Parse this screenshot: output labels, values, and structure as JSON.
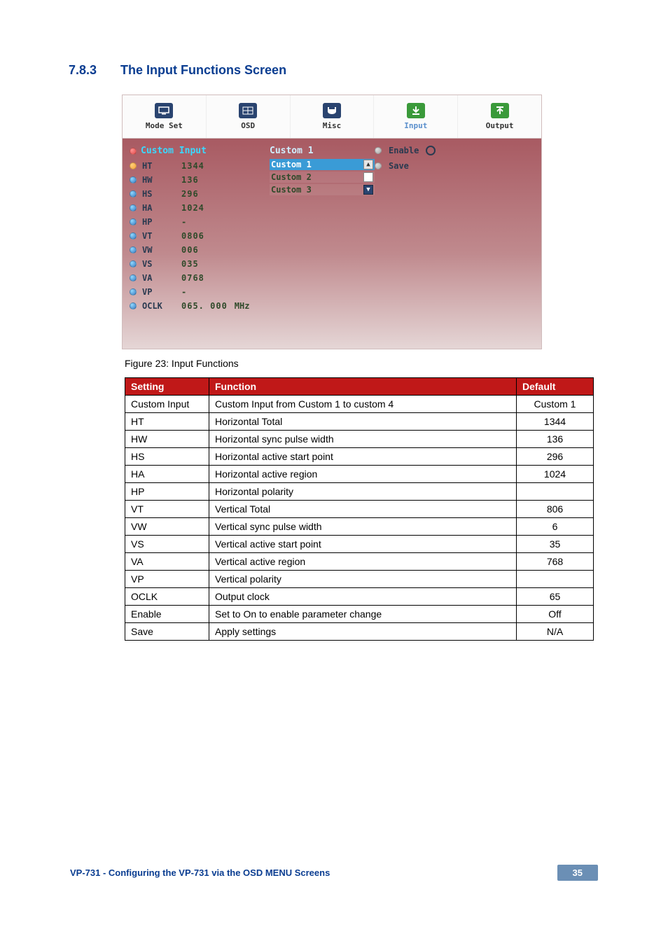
{
  "section": {
    "number": "7.8.3",
    "title": "The Input Functions Screen"
  },
  "osd": {
    "tabs": {
      "modeset": "Mode Set",
      "osd": "OSD",
      "misc": "Misc",
      "input": "Input",
      "output": "Output"
    },
    "headline_custom_input": "Custom Input",
    "headline_custom_value": "Custom 1",
    "enable_label": "Enable",
    "save_label": "Save",
    "custom_list": {
      "c1": "Custom 1",
      "c2": "Custom 2",
      "c3": "Custom 3"
    },
    "params": {
      "ht": {
        "label": "HT",
        "value": "1344"
      },
      "hw": {
        "label": "HW",
        "value": "136"
      },
      "hs": {
        "label": "HS",
        "value": "296"
      },
      "ha": {
        "label": "HA",
        "value": "1024"
      },
      "hp": {
        "label": "HP",
        "value": "-"
      },
      "vt": {
        "label": "VT",
        "value": "0806"
      },
      "vw": {
        "label": "VW",
        "value": "006"
      },
      "vs": {
        "label": "VS",
        "value": "035"
      },
      "va": {
        "label": "VA",
        "value": "0768"
      },
      "vp": {
        "label": "VP",
        "value": "-"
      },
      "oclk": {
        "label": "OCLK",
        "value": "065. 000",
        "unit": "MHz"
      }
    }
  },
  "caption": "Figure 23: Input Functions",
  "table": {
    "headers": {
      "setting": "Setting",
      "function": "Function",
      "default": "Default"
    },
    "rows": {
      "r0": {
        "s": "Custom Input",
        "f": "Custom Input from Custom 1 to custom 4",
        "d": "Custom 1"
      },
      "r1": {
        "s": "HT",
        "f": "Horizontal Total",
        "d": "1344"
      },
      "r2": {
        "s": "HW",
        "f": "Horizontal sync pulse width",
        "d": "136"
      },
      "r3": {
        "s": "HS",
        "f": "Horizontal active start point",
        "d": "296"
      },
      "r4": {
        "s": "HA",
        "f": "Horizontal active region",
        "d": "1024"
      },
      "r5": {
        "s": "HP",
        "f": "Horizontal polarity",
        "d": ""
      },
      "r6": {
        "s": "VT",
        "f": "Vertical Total",
        "d": "806"
      },
      "r7": {
        "s": "VW",
        "f": "Vertical sync pulse width",
        "d": "6"
      },
      "r8": {
        "s": "VS",
        "f": "Vertical active start point",
        "d": "35"
      },
      "r9": {
        "s": "VA",
        "f": "Vertical active region",
        "d": "768"
      },
      "r10": {
        "s": "VP",
        "f": "Vertical polarity",
        "d": ""
      },
      "r11": {
        "s": "OCLK",
        "f": "Output clock",
        "d": "65"
      },
      "r12": {
        "s": "Enable",
        "f": "Set to On to enable parameter change",
        "d": "Off"
      },
      "r13": {
        "s": "Save",
        "f": "Apply settings",
        "d": "N/A"
      }
    }
  },
  "footer": {
    "text": "VP-731 - Configuring the VP-731 via the OSD MENU Screens",
    "page": "35"
  }
}
